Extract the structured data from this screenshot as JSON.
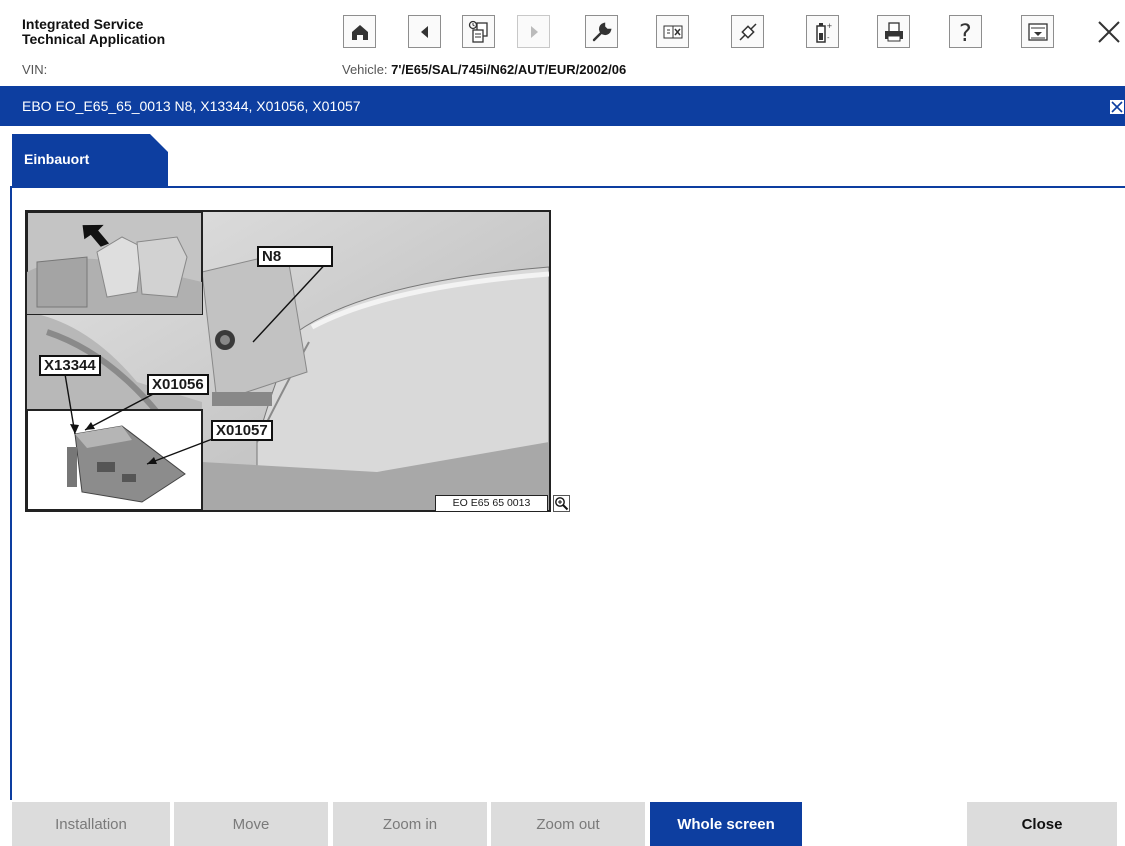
{
  "app": {
    "title_line1": "Integrated Service",
    "title_line2": "Technical Application"
  },
  "toolbar": {
    "buttons": [
      {
        "icon": "home-icon",
        "enabled": true
      },
      {
        "icon": "back-icon",
        "enabled": true
      },
      {
        "icon": "documents-icon",
        "enabled": true
      },
      {
        "icon": "forward-icon",
        "enabled": false
      },
      {
        "icon": "wrench-icon",
        "enabled": true
      },
      {
        "icon": "split-view-icon",
        "enabled": true
      },
      {
        "icon": "connector-icon",
        "enabled": true
      },
      {
        "icon": "battery-icon",
        "enabled": true
      },
      {
        "icon": "printer-icon",
        "enabled": true
      },
      {
        "icon": "help-icon",
        "enabled": true
      },
      {
        "icon": "dropdown-icon",
        "enabled": true
      },
      {
        "icon": "close-icon",
        "enabled": true
      }
    ]
  },
  "vehicle_row": {
    "vin_label": "VIN:",
    "vehicle_label": "Vehicle:",
    "vehicle_value": "7'/E65/SAL/745i/N62/AUT/EUR/2002/06"
  },
  "document": {
    "title": "EBO EO_E65_65_0013 N8, X13344, X01056, X01057"
  },
  "tabs": [
    {
      "label": "Einbauort",
      "active": true
    }
  ],
  "figure": {
    "callouts": {
      "n8": "N8",
      "x13344": "X13344",
      "x01056": "X01056",
      "x01057": "X01057"
    },
    "caption": "EO E65 65 0013"
  },
  "bottom_buttons": [
    {
      "label": "Installation",
      "state": "disabled"
    },
    {
      "label": "Move",
      "state": "disabled"
    },
    {
      "label": "Zoom in",
      "state": "disabled"
    },
    {
      "label": "Zoom out",
      "state": "disabled"
    },
    {
      "label": "Whole screen",
      "state": "active"
    },
    {
      "label": "Close",
      "state": "enabled"
    }
  ],
  "colors": {
    "brand_blue": "#0d3ea0",
    "button_grey": "#dcdcdc"
  }
}
